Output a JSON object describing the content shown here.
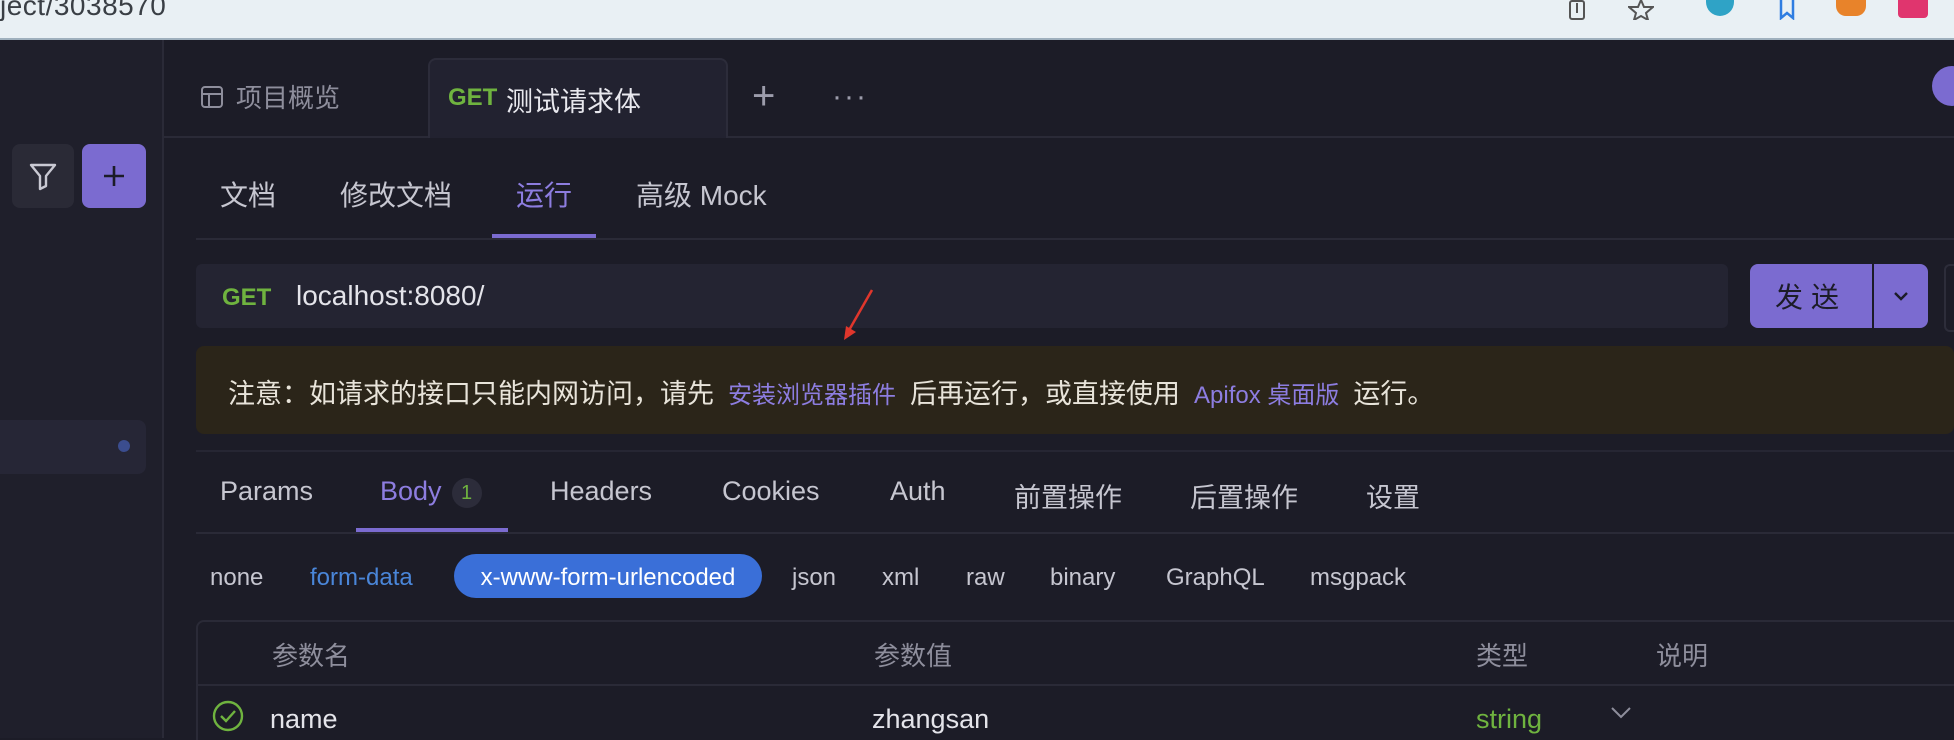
{
  "browser": {
    "url_fragment": "ject/3038570"
  },
  "tabs": {
    "overview_label": "项目概览",
    "active_method": "GET",
    "active_title": "测试请求体",
    "plus": "+",
    "more": "···"
  },
  "subtabs": [
    "文档",
    "修改文档",
    "运行",
    "高级 Mock"
  ],
  "request": {
    "method": "GET",
    "url": "localhost:8080/",
    "send_label": "发送"
  },
  "notice": {
    "prefix": "注意：如请求的接口只能内网访问，请先",
    "link1": "安装浏览器插件",
    "middle": "后再运行，或直接使用",
    "link2": "Apifox 桌面版",
    "suffix": "运行。"
  },
  "param_tabs": {
    "params": "Params",
    "body": "Body",
    "body_count": "1",
    "headers": "Headers",
    "cookies": "Cookies",
    "auth": "Auth",
    "pre": "前置操作",
    "post": "后置操作",
    "settings": "设置"
  },
  "body_types": {
    "none": "none",
    "form_data": "form-data",
    "urlencoded": "x-www-form-urlencoded",
    "json": "json",
    "xml": "xml",
    "raw": "raw",
    "binary": "binary",
    "graphql": "GraphQL",
    "msgpack": "msgpack"
  },
  "table": {
    "headers": [
      "参数名",
      "参数值",
      "类型",
      "说明"
    ],
    "rows": [
      {
        "name": "name",
        "value": "zhangsan",
        "type": "string"
      }
    ]
  },
  "colors": {
    "accent": "#7b6bd0",
    "get_green": "#6fb33f",
    "link_blue": "#4a86d9",
    "pill_blue": "#3a6fd8",
    "annotation_red": "#e0362c"
  }
}
